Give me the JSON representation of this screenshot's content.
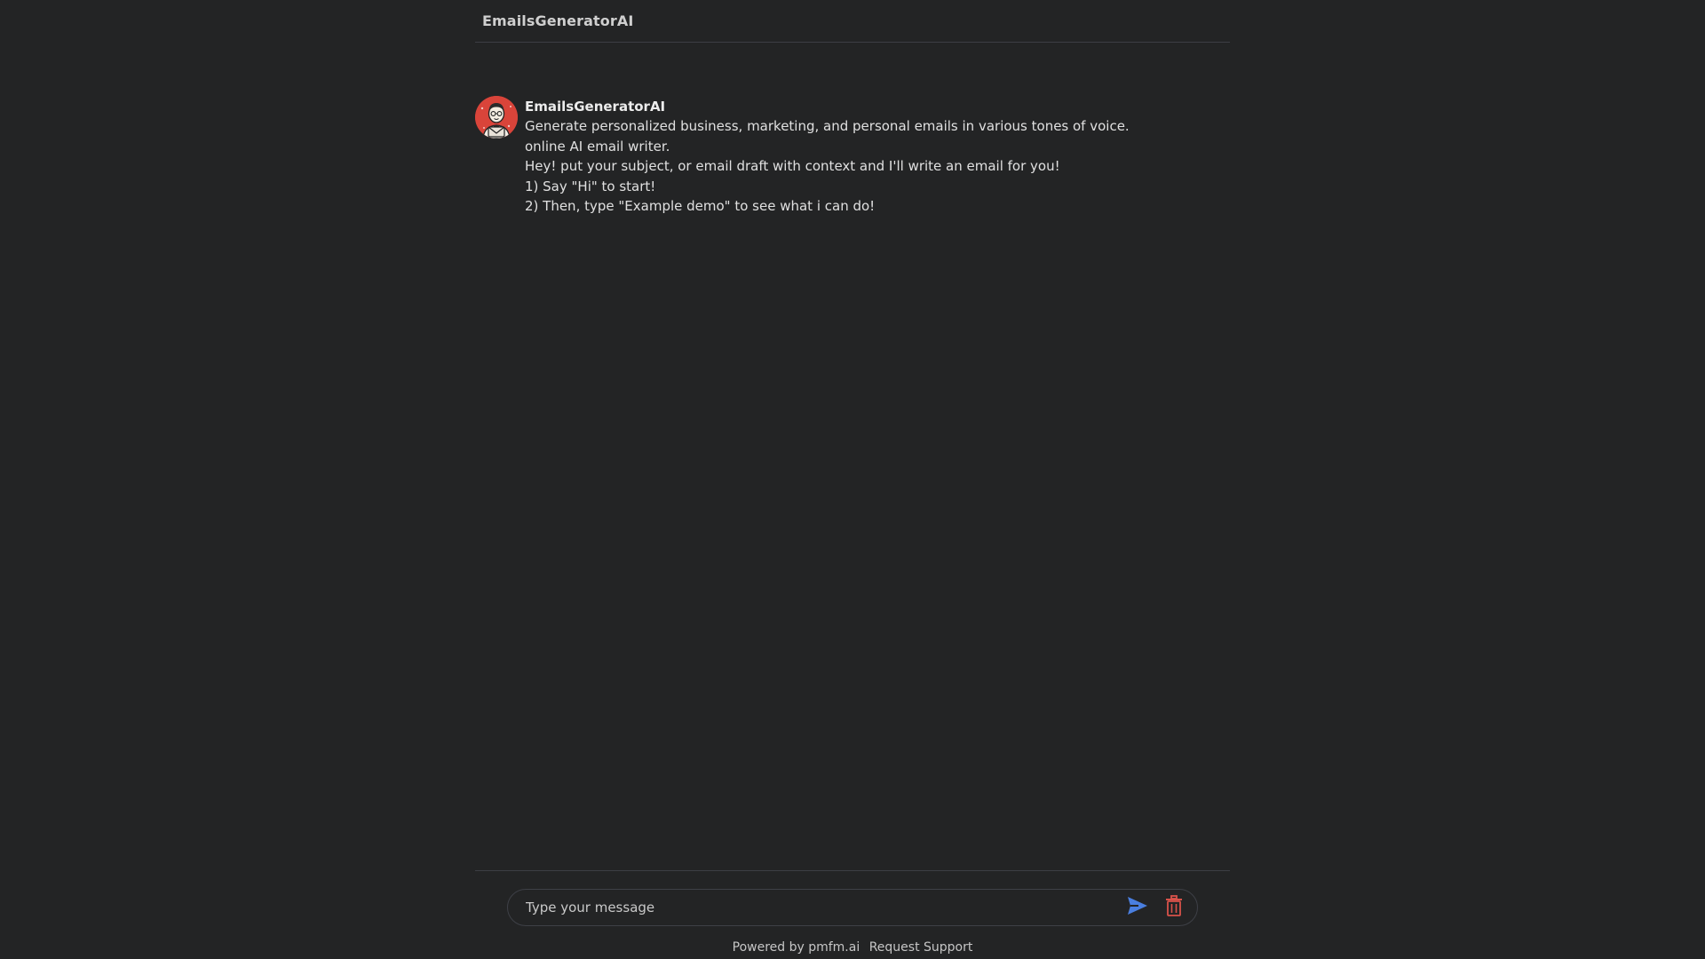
{
  "header": {
    "title": "EmailsGeneratorAI"
  },
  "message": {
    "sender": "EmailsGeneratorAI",
    "avatar_icon": "robot-avatar-icon",
    "lines": [
      "Generate personalized business, marketing, and personal emails in various tones of voice.",
      "online AI email writer.",
      "Hey! put your subject, or email draft with context and I'll write an email for you!",
      "1) Say \"Hi\" to start!",
      "2) Then, type \"Example demo\" to see what i can do!"
    ]
  },
  "composer": {
    "placeholder": "Type your message",
    "value": "",
    "send_icon": "send-icon",
    "delete_icon": "trash-icon"
  },
  "footer": {
    "powered_by": "Powered by pmfm.ai",
    "support": "Request Support"
  },
  "colors": {
    "background": "#232425",
    "divider": "#3c3e44",
    "send_accent": "#4a7fe0",
    "delete_accent": "#d9524a",
    "avatar_bg": "#d9443a"
  }
}
